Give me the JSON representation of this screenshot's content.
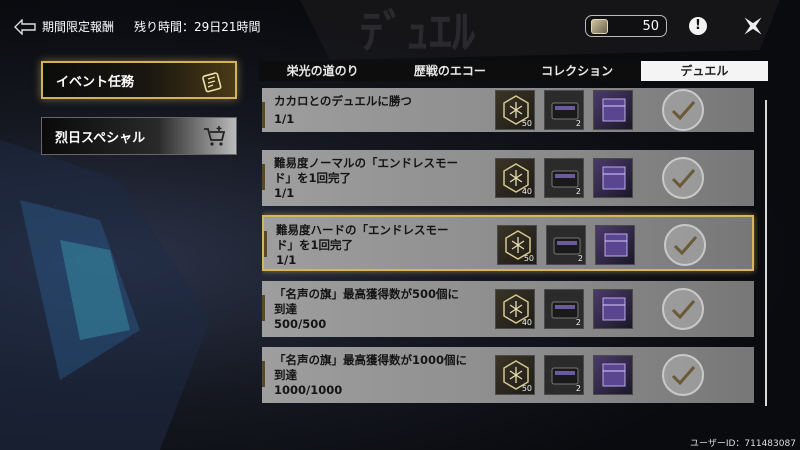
{
  "header": {
    "title": "期間限定報酬",
    "timer": "残り時間：29日21時間"
  },
  "currency": {
    "amount": "50",
    "icon": "coin-icon"
  },
  "sidebar": {
    "items": [
      {
        "label": "イベント任務",
        "active": true,
        "icon": "task-card-icon"
      },
      {
        "label": "烈日スペシャル",
        "active": false,
        "icon": "cart-icon"
      }
    ]
  },
  "tabs": [
    {
      "label": "栄光の道のり",
      "active": false
    },
    {
      "label": "歴戦のエコー",
      "active": false
    },
    {
      "label": "コレクション",
      "active": false
    },
    {
      "label": "デュエル",
      "active": true
    }
  ],
  "missions": [
    {
      "title": "カカロとのデュエルに勝つ",
      "progress": "1/1",
      "rewards": [
        "50",
        "2",
        ""
      ],
      "completed": true,
      "highlight": false
    },
    {
      "title": "難易度ノーマルの「エンドレスモー\nド」を1回完了",
      "progress": "1/1",
      "rewards": [
        "40",
        "2",
        ""
      ],
      "completed": true,
      "highlight": false
    },
    {
      "title": "難易度ハードの「エンドレスモー\nド」を1回完了",
      "progress": "1/1",
      "rewards": [
        "50",
        "2",
        ""
      ],
      "completed": true,
      "highlight": true
    },
    {
      "title": "「名声の旗」最高獲得数が500個に\n到達",
      "progress": "500/500",
      "rewards": [
        "40",
        "2",
        ""
      ],
      "completed": true,
      "highlight": false
    },
    {
      "title": "「名声の旗」最高獲得数が1000個に\n到達",
      "progress": "1000/1000",
      "rewards": [
        "50",
        "2",
        ""
      ],
      "completed": true,
      "highlight": false
    }
  ],
  "footer": {
    "user_id": "ユーザーID：711483087"
  },
  "colors": {
    "accent_gold": "#d3b25a",
    "row_bg": "#9a9a9a",
    "tab_active": "#f4f4f4"
  }
}
